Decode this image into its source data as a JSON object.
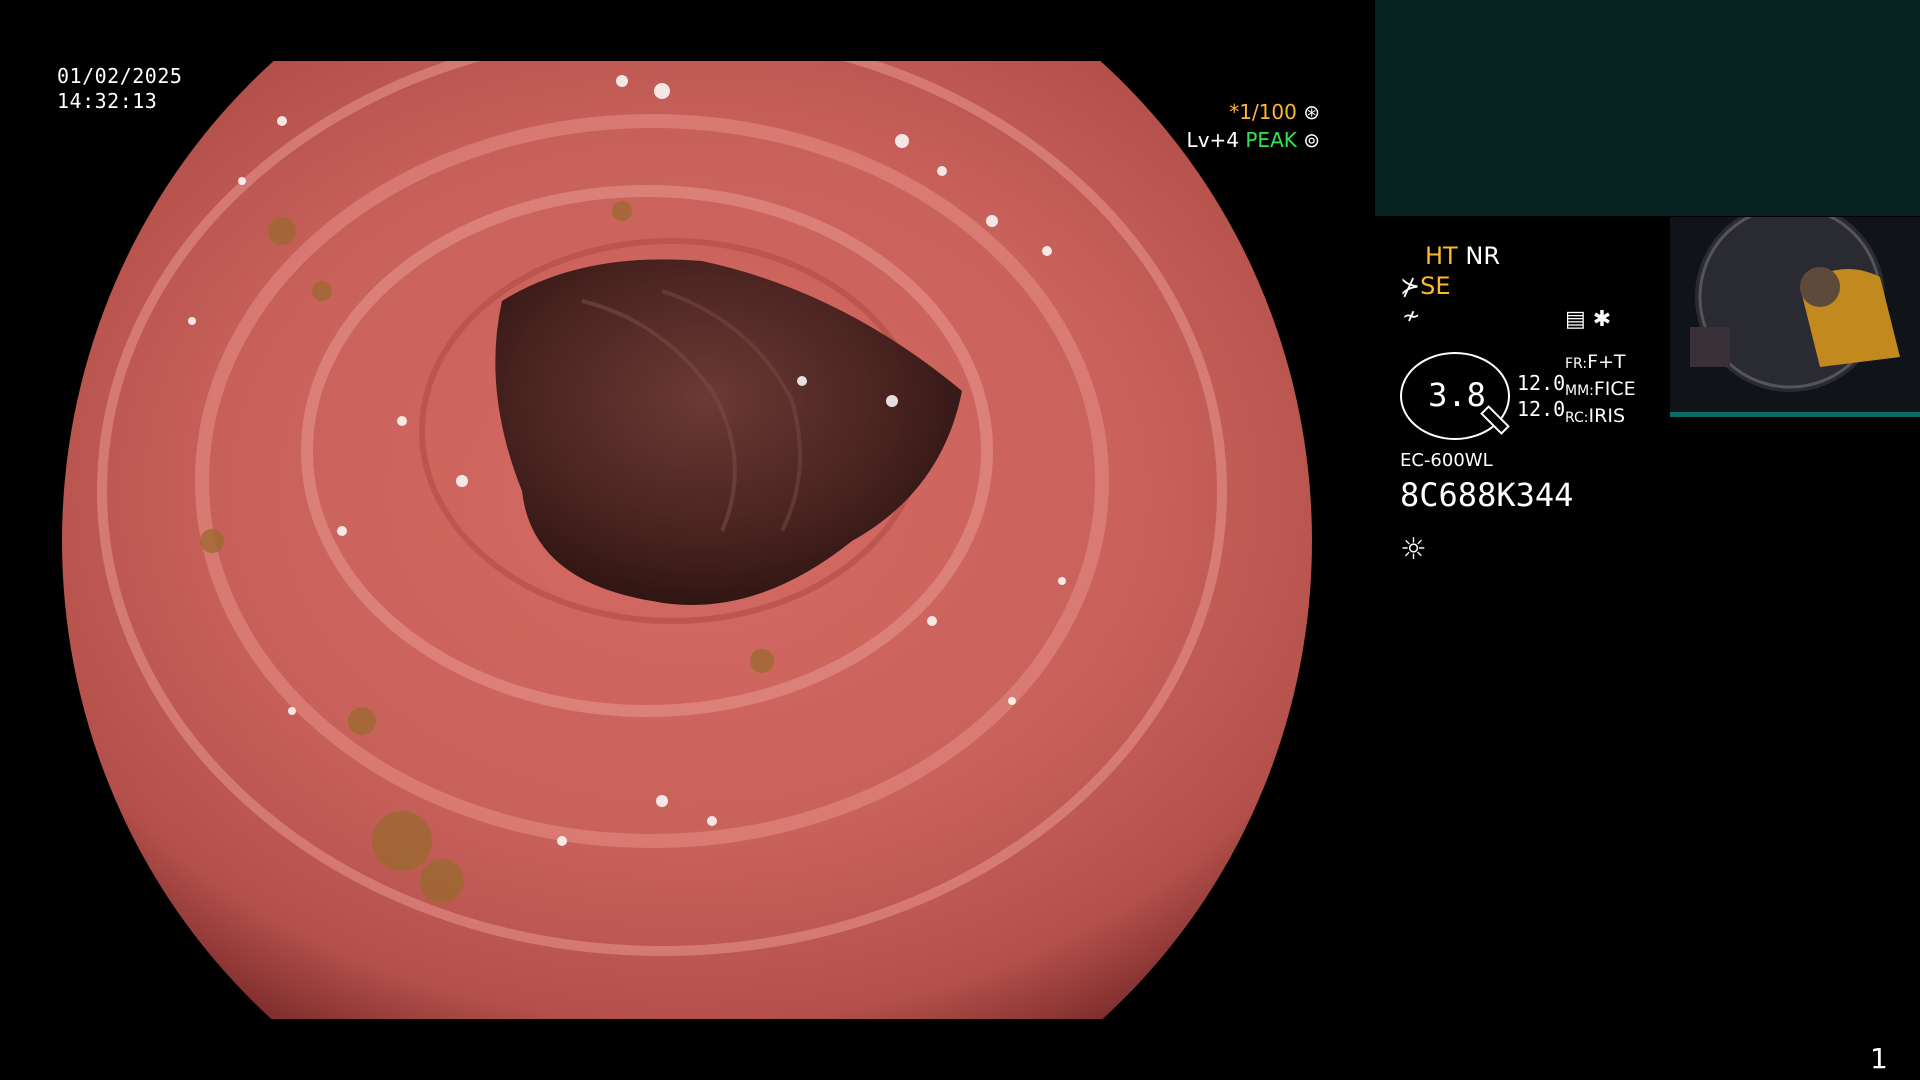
{
  "overlay": {
    "date": "01/02/2025",
    "time": "14:32:13",
    "shutter": "*1/100",
    "shutter_icon": "⊛",
    "level": "Lv+4",
    "peak": "PEAK",
    "peak_icon": "⊚"
  },
  "panel": {
    "ht": "HT",
    "nr": "NR",
    "se_icon": "⊁",
    "se": "SE",
    "tilde_icon": "≁",
    "mode_icon": "▤",
    "star": "✱",
    "ring_value": "3.8",
    "num1": "12.0",
    "num2": "12.0",
    "fr_label": "FR:",
    "fr_value": "F+T",
    "mm_label": "MM:",
    "mm_value": "FICE",
    "rc_label": "RC:",
    "rc_value": "IRIS",
    "model": "EC-600WL",
    "serial": "8C688K344",
    "light_icon": "☼"
  },
  "footer": {
    "page": "1"
  },
  "colors": {
    "accent_orange": "#ffb732",
    "accent_green": "#34e34f",
    "preview_bg": "#062322"
  }
}
